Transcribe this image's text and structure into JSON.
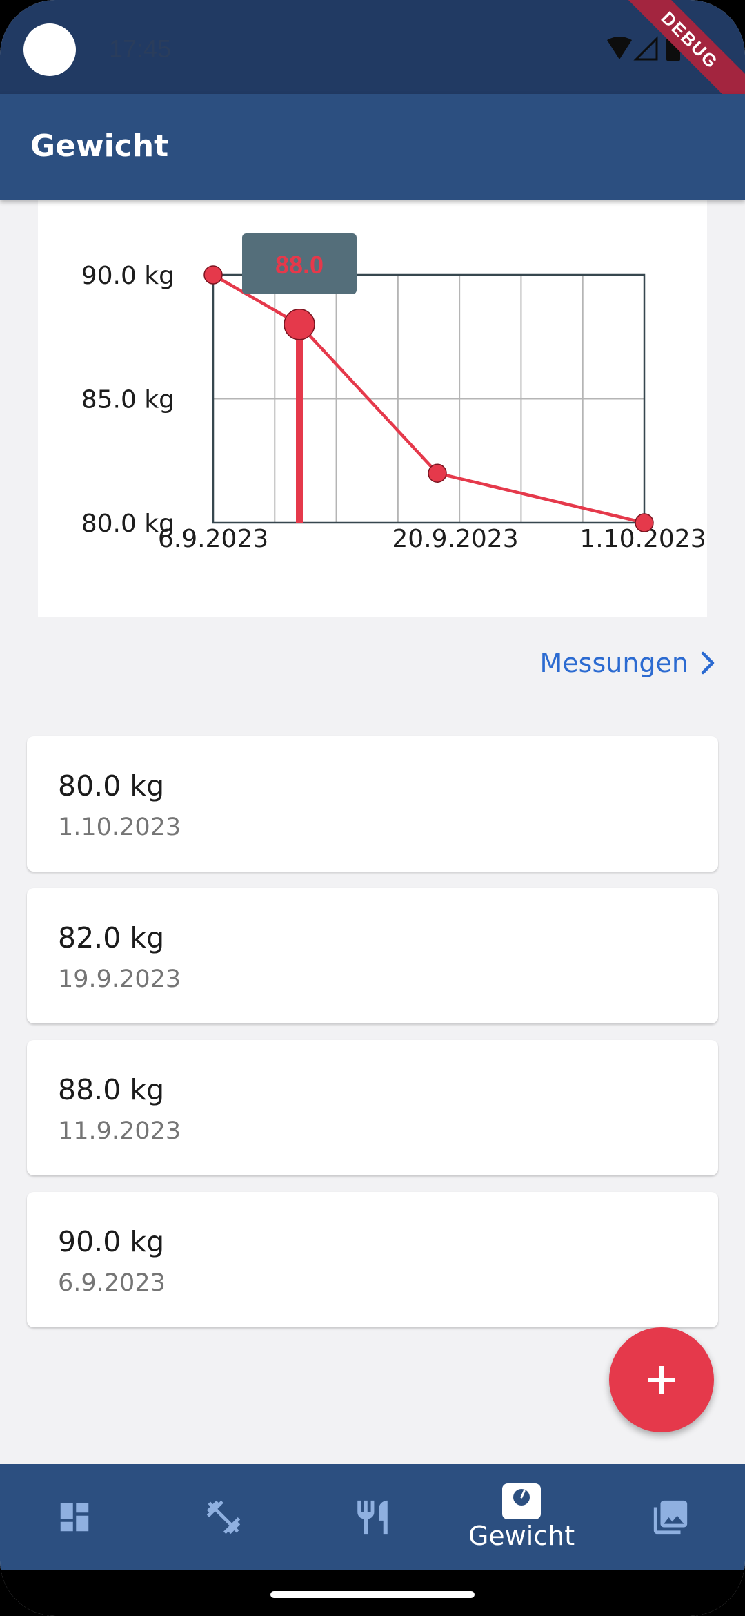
{
  "status_bar": {
    "time": "17:45",
    "debug_label": "DEBUG"
  },
  "app_bar": {
    "title": "Gewicht"
  },
  "chart_data": {
    "type": "line",
    "y_tick_labels": [
      "90.0 kg",
      "85.0 kg",
      "80.0 kg"
    ],
    "x_tick_labels": [
      "6.9.2023",
      "20.9.2023",
      "1.10.2023"
    ],
    "ylim": [
      80,
      90
    ],
    "xlim": [
      "6.9.2023",
      "1.10.2023"
    ],
    "series": [
      {
        "x": [
          "6.9.2023",
          "11.9.2023",
          "19.9.2023",
          "1.10.2023"
        ],
        "y": [
          90.0,
          88.0,
          82.0,
          80.0
        ]
      }
    ],
    "tooltip": {
      "label": "88.0",
      "x": "11.9.2023",
      "y": 88.0
    },
    "line_color": "#e5394b",
    "tooltip_bg": "#546e7a",
    "grid": true
  },
  "measurements_link": {
    "label": "Messungen"
  },
  "entries": [
    {
      "weight": "80.0 kg",
      "date": "1.10.2023"
    },
    {
      "weight": "82.0 kg",
      "date": "19.9.2023"
    },
    {
      "weight": "88.0 kg",
      "date": "11.9.2023"
    },
    {
      "weight": "90.0 kg",
      "date": "6.9.2023"
    }
  ],
  "fab": {
    "icon": "plus-icon"
  },
  "bottom_nav": {
    "items": [
      {
        "icon": "dashboard-icon"
      },
      {
        "icon": "dumbbell-icon"
      },
      {
        "icon": "restaurant-icon"
      },
      {
        "icon": "scale-icon",
        "label": "Gewicht",
        "active": true
      },
      {
        "icon": "gallery-icon"
      }
    ]
  },
  "colors": {
    "primary": "#2c4f80",
    "accent": "#e5394b",
    "link": "#2c6bd1"
  }
}
